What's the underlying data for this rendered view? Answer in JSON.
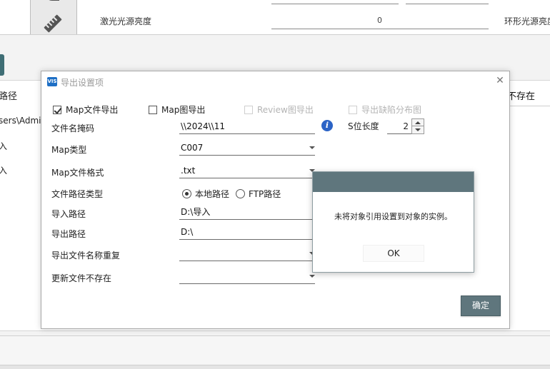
{
  "background": {
    "laser_brightness_label": "激光光源亮度",
    "laser_brightness_value": "0",
    "ring_brightness_label": "环形光源亮度",
    "left_column": [
      "路径",
      "sers\\Admi",
      "入",
      "入"
    ],
    "right_column_header": "不存在"
  },
  "dialog": {
    "title": "导出设置项",
    "icon_text": "VIS",
    "checkboxes": [
      {
        "label": "Map文件导出",
        "checked": true,
        "enabled": true
      },
      {
        "label": "Map图导出",
        "checked": false,
        "enabled": true
      },
      {
        "label": "Review图导出",
        "checked": false,
        "enabled": false
      },
      {
        "label": "导出缺陷分布图",
        "checked": false,
        "enabled": false
      }
    ],
    "rows": {
      "file_mask": {
        "label": "文件名掩码",
        "value": "\\\\2024\\\\11"
      },
      "s_length": {
        "label": "S位长度",
        "value": "2"
      },
      "map_type": {
        "label": "Map类型",
        "value": "C007"
      },
      "map_format": {
        "label": "Map文件格式",
        "value": ".txt"
      },
      "path_type": {
        "label": "文件路径类型",
        "options": [
          "本地路径",
          "FTP路径"
        ],
        "selected": "本地路径"
      },
      "import_path": {
        "label": "导入路径",
        "value": "D:\\导入"
      },
      "export_path": {
        "label": "导出路径",
        "value": "D:\\"
      },
      "duplicate_name": {
        "label": "导出文件名称重复",
        "value": ""
      },
      "update_missing": {
        "label": "更新文件不存在",
        "value": ""
      }
    },
    "confirm_label": "确定"
  },
  "message_box": {
    "text": "未将对象引用设置到对象的实例。",
    "ok_label": "OK"
  },
  "colors": {
    "accent_teal": "#5f767d",
    "info_blue": "#2b63c6"
  }
}
